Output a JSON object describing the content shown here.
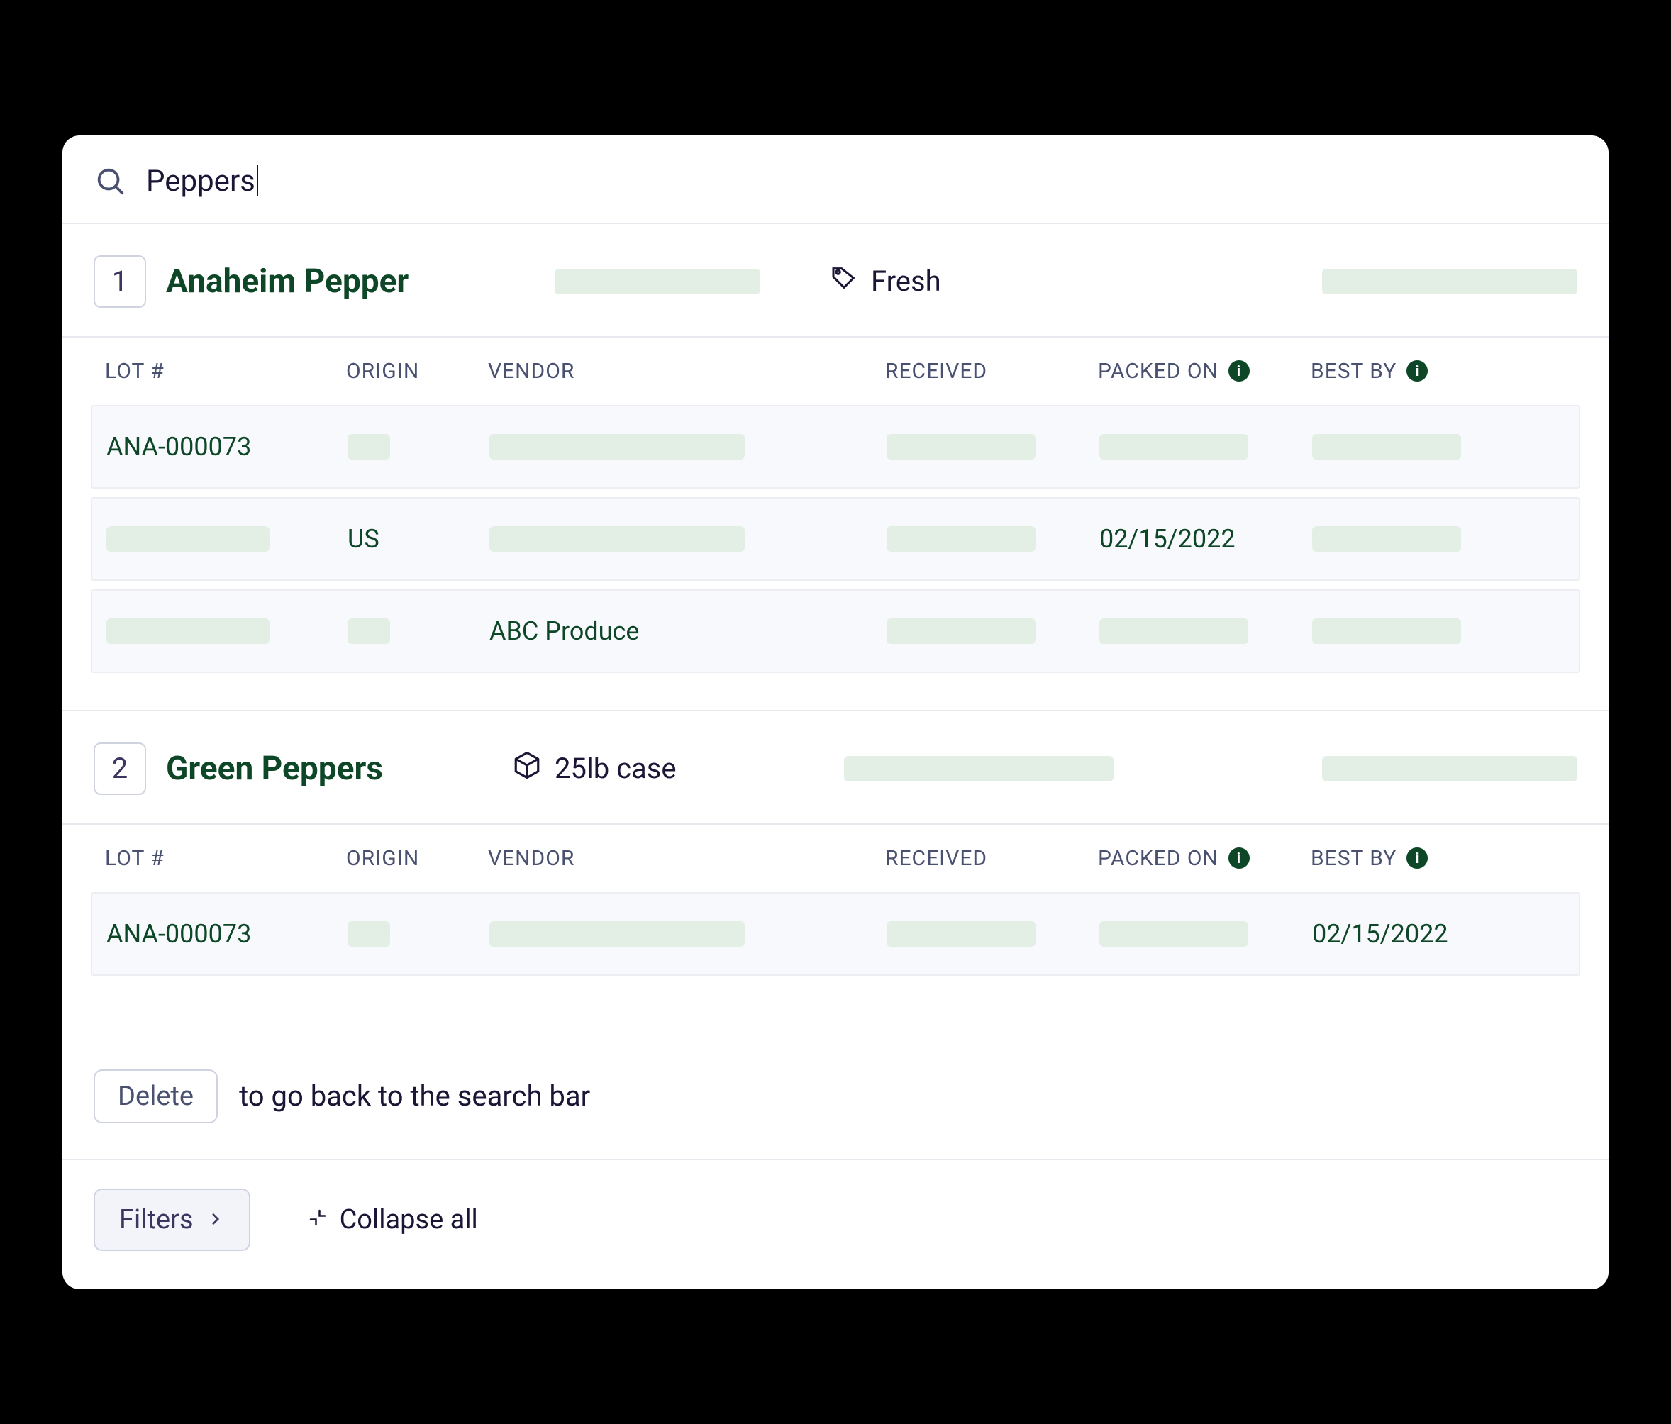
{
  "search": {
    "value": "Peppers"
  },
  "columns": {
    "lot": "LOT #",
    "origin": "ORIGIN",
    "vendor": "VENDOR",
    "received": "RECEIVED",
    "packed_on": "PACKED ON",
    "best_by": "BEST BY"
  },
  "sections": [
    {
      "index": "1",
      "title": "Anaheim Pepper",
      "tag": "Fresh",
      "package": "",
      "rows": [
        {
          "lot": "ANA-000073",
          "origin": "",
          "vendor": "",
          "received": "",
          "packed_on": "",
          "best_by": ""
        },
        {
          "lot": "",
          "origin": "US",
          "vendor": "",
          "received": "",
          "packed_on": "02/15/2022",
          "best_by": ""
        },
        {
          "lot": "",
          "origin": "",
          "vendor": "ABC Produce",
          "received": "",
          "packed_on": "",
          "best_by": ""
        }
      ]
    },
    {
      "index": "2",
      "title": "Green Peppers",
      "tag": "",
      "package": "25lb case",
      "rows": [
        {
          "lot": "ANA-000073",
          "origin": "",
          "vendor": "",
          "received": "",
          "packed_on": "",
          "best_by": "02/15/2022"
        }
      ]
    }
  ],
  "hint": {
    "key": "Delete",
    "text": "to go back to the search bar"
  },
  "footer": {
    "filters": "Filters",
    "collapse": "Collapse all"
  }
}
